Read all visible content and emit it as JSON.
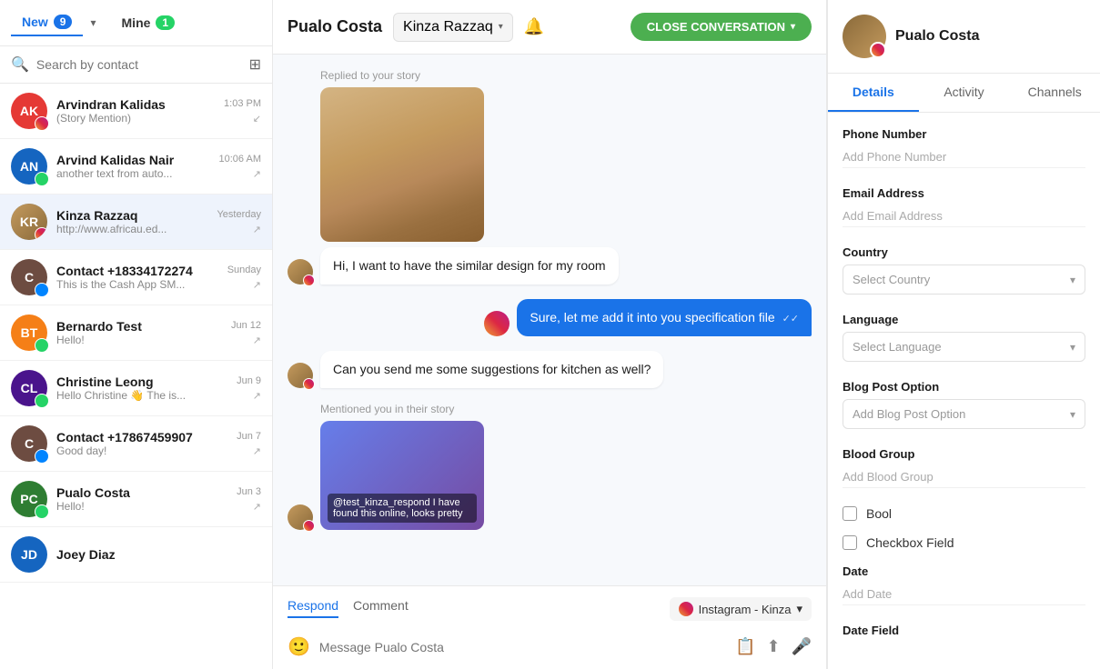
{
  "sidebar": {
    "tab_new_label": "New",
    "tab_new_badge": "9",
    "tab_mine_label": "Mine",
    "tab_mine_badge": "1",
    "search_placeholder": "Search by contact",
    "contacts": [
      {
        "id": "AK",
        "name": "Arvindran Kalidas",
        "preview": "(Story Mention)",
        "time": "1:03 PM",
        "color": "#e53935",
        "platform": "instagram",
        "outgoing": false
      },
      {
        "id": "AN",
        "name": "Arvind Kalidas Nair",
        "preview": "another text from auto...",
        "time": "10:06 AM",
        "color": "#1565c0",
        "platform": "whatsapp",
        "outgoing": true
      },
      {
        "id": "KR",
        "name": "Kinza Razzaq",
        "preview": "http://www.africau.ed...",
        "time": "Yesterday",
        "color": null,
        "platform": "instagram",
        "outgoing": true,
        "isPhoto": true
      },
      {
        "id": "C",
        "name": "Contact +18334172274",
        "preview": "This is the Cash App SM...",
        "time": "Sunday",
        "color": "#6d4c41",
        "platform": "messenger",
        "outgoing": true
      },
      {
        "id": "BT",
        "name": "Bernardo Test",
        "preview": "Hello!",
        "time": "Jun 12",
        "color": "#f57f17",
        "platform": "whatsapp",
        "outgoing": true
      },
      {
        "id": "CL",
        "name": "Christine Leong",
        "preview": "Hello Christine 👋 The is...",
        "time": "Jun 9",
        "color": "#4a148c",
        "platform": "whatsapp",
        "outgoing": true
      },
      {
        "id": "C2",
        "name": "Contact +17867459907",
        "preview": "Good day!",
        "time": "Jun 7",
        "color": "#6d4c41",
        "platform": "messenger",
        "outgoing": true
      },
      {
        "id": "PC",
        "name": "Pualo Costa",
        "preview": "Hello!",
        "time": "Jun 3",
        "color": "#2e7d32",
        "platform": "whatsapp",
        "outgoing": true
      },
      {
        "id": "JD",
        "name": "Joey Diaz",
        "preview": "",
        "time": "",
        "color": "#1565c0",
        "platform": null,
        "outgoing": false
      }
    ]
  },
  "chat": {
    "title": "Pualo Costa",
    "assignee": "Kinza Razzaq",
    "close_btn": "CLOSE CONVERSATION",
    "replied_to_story": "Replied to your story",
    "msg1": "Hi, I want to have the similar design for my room",
    "msg2": "Sure, let me add it into you specification file",
    "msg3": "Can you send me some suggestions for kitchen as well?",
    "mentioned_in_story": "Mentioned you in their story",
    "story_mention_text": "@test_kinza_respond I have found this online, looks pretty",
    "respond_tab": "Respond",
    "comment_tab": "Comment",
    "platform_label": "Instagram - Kinza",
    "msg_placeholder": "Message Pualo Costa"
  },
  "right_panel": {
    "contact_name": "Pualo Costa",
    "tab_details": "Details",
    "tab_activity": "Activity",
    "tab_channels": "Channels",
    "phone_label": "Phone Number",
    "phone_placeholder": "Add Phone Number",
    "email_label": "Email Address",
    "email_placeholder": "Add Email Address",
    "country_label": "Country",
    "country_placeholder": "Select Country",
    "language_label": "Language",
    "language_placeholder": "Select Language",
    "blog_post_label": "Blog Post Option",
    "blog_post_placeholder": "Add Blog Post Option",
    "blood_group_label": "Blood Group",
    "blood_group_placeholder": "Add Blood Group",
    "bool_label": "Bool",
    "checkbox_label": "Checkbox Field",
    "date_label": "Date",
    "date_placeholder": "Add Date",
    "date_field_label": "Date Field"
  },
  "colors": {
    "instagram_gradient": "linear-gradient(45deg, #f09433, #e6683c, #dc2743, #cc2366, #bc1888)",
    "whatsapp": "#25d366",
    "primary": "#1a73e8",
    "close_green": "#4caf50"
  }
}
